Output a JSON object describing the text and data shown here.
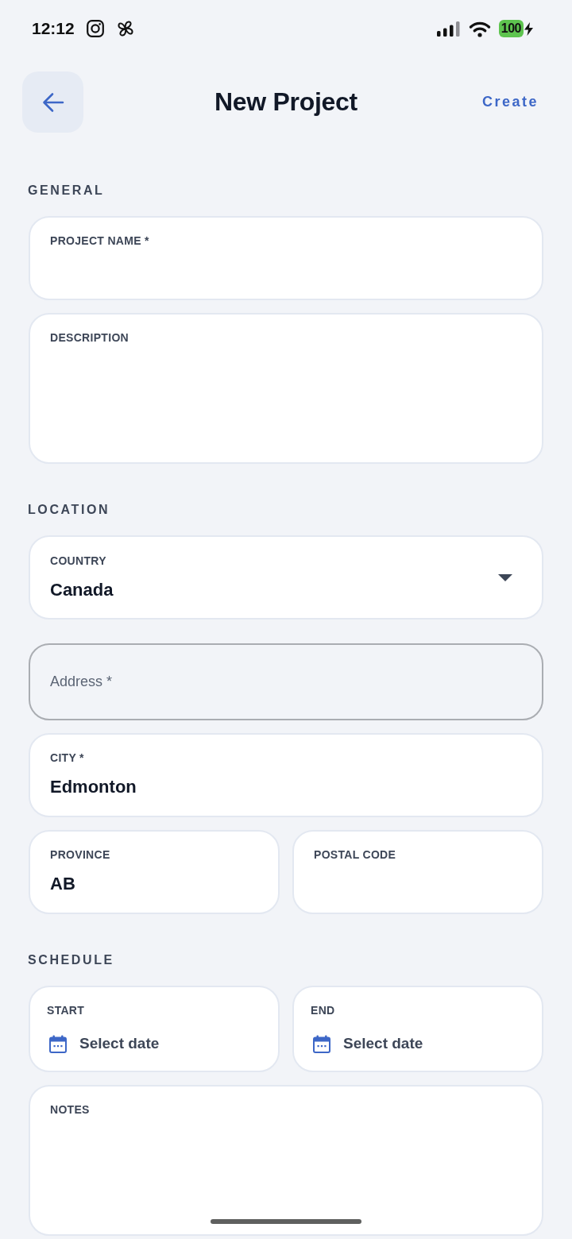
{
  "status_bar": {
    "time": "12:12",
    "battery_text": "100"
  },
  "header": {
    "title": "New Project",
    "action": "Create"
  },
  "sections": [
    {
      "title": "GENERAL",
      "fields": [
        {
          "kind": "text",
          "label": "PROJECT NAME *"
        },
        {
          "kind": "textarea",
          "label": "DESCRIPTION"
        }
      ]
    },
    {
      "title": "LOCATION",
      "fields": [
        {
          "kind": "select",
          "label": "COUNTRY",
          "value": "Canada"
        },
        {
          "kind": "outlined",
          "placeholder": "Address *"
        },
        {
          "kind": "text",
          "label": "CITY *",
          "value": "Edmonton"
        },
        {
          "kind": "row",
          "fields": [
            {
              "kind": "text",
              "label": "PROVINCE",
              "value": "AB"
            },
            {
              "kind": "text",
              "label": "POSTAL CODE"
            }
          ]
        }
      ]
    },
    {
      "title": "SCHEDULE",
      "fields": [
        {
          "kind": "row",
          "fields": [
            {
              "kind": "date",
              "label": "START",
              "placeholder": "Select date"
            },
            {
              "kind": "date",
              "label": "END",
              "placeholder": "Select date"
            }
          ]
        },
        {
          "kind": "textarea",
          "label": "NOTES"
        }
      ]
    }
  ]
}
